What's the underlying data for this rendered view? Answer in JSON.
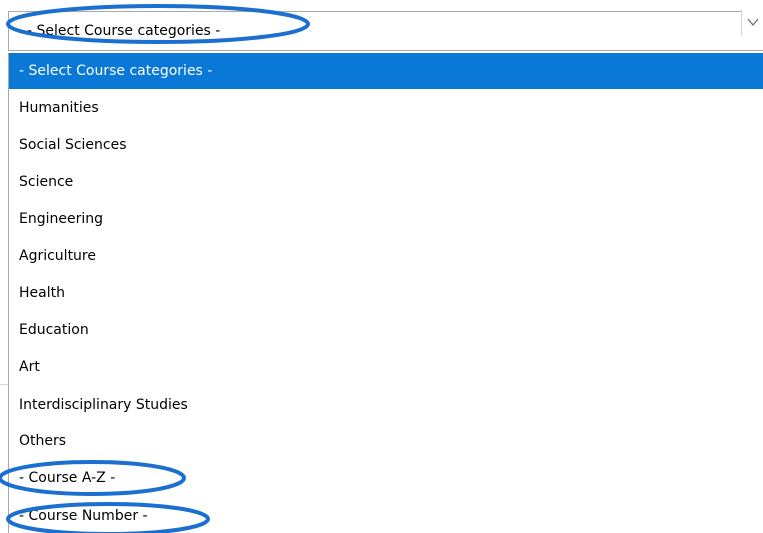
{
  "select": {
    "selected_value": "- Select Course categories -"
  },
  "options": [
    {
      "label": "- Select Course categories -",
      "selected": true
    },
    {
      "label": "Humanities",
      "selected": false
    },
    {
      "label": "Social Sciences",
      "selected": false
    },
    {
      "label": "Science",
      "selected": false
    },
    {
      "label": "Engineering",
      "selected": false
    },
    {
      "label": "Agriculture",
      "selected": false
    },
    {
      "label": "Health",
      "selected": false
    },
    {
      "label": "Education",
      "selected": false
    },
    {
      "label": "Art",
      "selected": false
    },
    {
      "label": "Interdisciplinary Studies",
      "selected": false
    },
    {
      "label": "Others",
      "selected": false
    },
    {
      "label": "- Course A-Z -",
      "selected": false
    },
    {
      "label": "- Course Number -",
      "selected": false
    }
  ],
  "icons": {
    "dropdown_arrow": "chevron-down-icon"
  },
  "colors": {
    "highlight": "#0a78d7",
    "annotation": "#1a6fd0"
  }
}
